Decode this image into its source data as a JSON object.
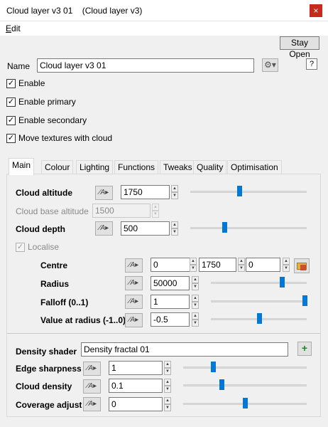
{
  "window": {
    "title": "Cloud layer v3 01    (Cloud layer v3)",
    "close": "×"
  },
  "menu": {
    "edit_first": "E",
    "edit_rest": "dit"
  },
  "stay_open": "Stay Open",
  "name": {
    "label": "Name",
    "value": "Cloud layer v3 01",
    "help": "?"
  },
  "checkboxes": {
    "enable": "Enable",
    "enable_primary": "Enable primary",
    "enable_secondary": "Enable secondary",
    "move_textures": "Move textures with cloud",
    "localise": "Localise"
  },
  "tabs": [
    "Main",
    "Colour",
    "Lighting",
    "Functions",
    "Tweaks",
    "Quality",
    "Optimisation"
  ],
  "fx_label": "∕A▸",
  "main": {
    "cloud_altitude": {
      "label": "Cloud altitude",
      "value": "1750",
      "slider": 0.42
    },
    "cloud_base_altitude": {
      "label": "Cloud base altitude",
      "value": "1500"
    },
    "cloud_depth": {
      "label": "Cloud depth",
      "value": "500",
      "slider": 0.29
    },
    "centre": {
      "label": "Centre",
      "x": "0",
      "y": "1750",
      "z": "0"
    },
    "radius": {
      "label": "Radius",
      "value": "50000",
      "slider": 0.74
    },
    "falloff": {
      "label": "Falloff (0..1)",
      "value": "1",
      "slider": 1.0
    },
    "value_at_radius": {
      "label": "Value at radius (-1..0)",
      "value": "-0.5",
      "slider": 0.5
    },
    "density_shader": {
      "label": "Density shader",
      "value": "Density fractal 01",
      "add": "+"
    },
    "edge_sharpness": {
      "label": "Edge sharpness",
      "value": "1",
      "slider": 0.24
    },
    "cloud_density": {
      "label": "Cloud density",
      "value": "0.1",
      "slider": 0.31
    },
    "coverage_adjust": {
      "label": "Coverage adjust",
      "value": "0",
      "slider": 0.5
    }
  }
}
